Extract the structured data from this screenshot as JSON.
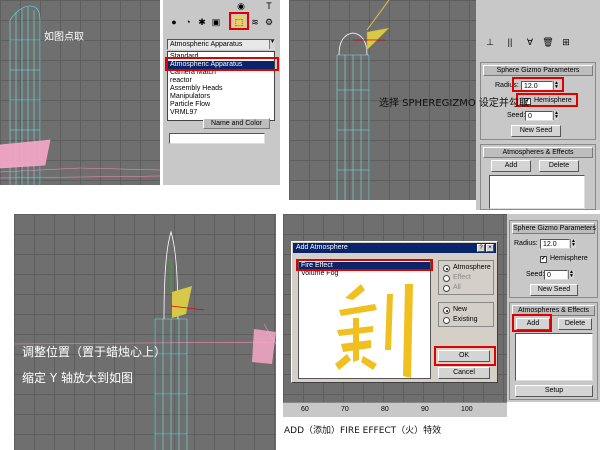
{
  "captions": {
    "panel1": "如图点取",
    "panel2": "选择 SPHEREGIZMO 设定并勾取",
    "panel3_line1": "调整位置（置于蜡烛心上）",
    "panel3_line2": "缩定 Y 轴放大到如图",
    "panel4": "ADD（添加）FIRE EFFECT（火）特效"
  },
  "helpers_panel": {
    "combo_value": "Atmospheric Apparatus",
    "dropdown_items": [
      "Standard",
      "Atmospheric Apparatus",
      "Camera Match",
      "reactor",
      "Assembly Heads",
      "Manipulators",
      "Particle Flow",
      "VRML97"
    ],
    "name_color_label": "Name and Color"
  },
  "sphere_gizmo": {
    "header": "Sphere Gizmo Parameters",
    "radius_label": "Radius:",
    "radius_value": "12.0",
    "hemisphere_label": "Hemisphere",
    "seed_label": "Seed:",
    "seed_value": "0",
    "new_seed_label": "New Seed"
  },
  "atmos_rollout": {
    "header": "Atmospheres & Effects",
    "add_label": "Add",
    "delete_label": "Delete",
    "setup_label": "Setup"
  },
  "add_atmosphere_dialog": {
    "title": "Add Atmosphere",
    "list_items": [
      "Fire Effect",
      "Volume Fog"
    ],
    "radio_group1": [
      "Atmosphere",
      "Effect",
      "All"
    ],
    "radio_group2": [
      "New",
      "Existing"
    ],
    "ok_label": "OK",
    "cancel_label": "Cancel"
  },
  "ruler_ticks": [
    "60",
    "70",
    "80",
    "90",
    "100"
  ],
  "colors": {
    "highlight_red": "#e00000",
    "selection_blue": "#0a246a",
    "viewport_gray": "#6f6f6f",
    "panel_gray": "#c8c8c8",
    "fire_yellow": "#f0c020"
  }
}
